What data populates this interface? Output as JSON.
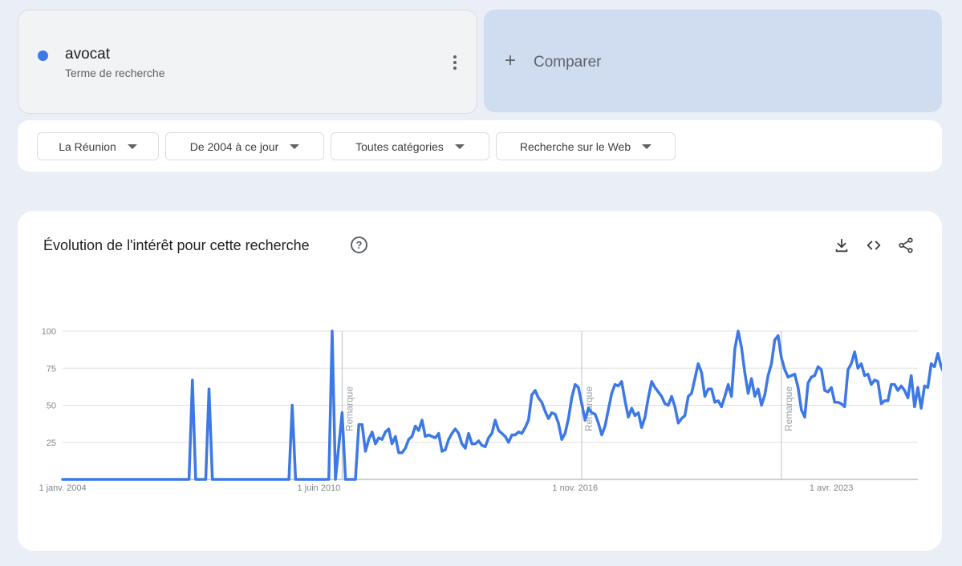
{
  "search_term": {
    "name": "avocat",
    "type_label": "Terme de recherche",
    "color": "#3c78e6"
  },
  "compare": {
    "label": "Comparer"
  },
  "filters": {
    "region": "La Réunion",
    "period": "De 2004 à ce jour",
    "category": "Toutes catégories",
    "search_type": "Recherche sur le Web"
  },
  "chart_card": {
    "title": "Évolution de l'intérêt pour cette recherche",
    "help": "?"
  },
  "chart_data": {
    "type": "line",
    "x_start": "2004-01",
    "x_end": "2025-06",
    "y_ticks": [
      "100",
      "75",
      "50",
      "25"
    ],
    "ylim": [
      0,
      100
    ],
    "x_ticks": [
      {
        "label": "1 janv. 2004",
        "date": "2004-01"
      },
      {
        "label": "1 juin 2010",
        "date": "2010-06"
      },
      {
        "label": "1 nov. 2016",
        "date": "2016-11"
      },
      {
        "label": "1 avr. 2023",
        "date": "2023-04"
      }
    ],
    "notes": [
      {
        "label": "Remarque",
        "date": "2011-01"
      },
      {
        "label": "Remarque",
        "date": "2017-01"
      },
      {
        "label": "Remarque",
        "date": "2022-01"
      }
    ],
    "series": [
      {
        "color": "#3c78e6",
        "points": [
          [
            "2004-01",
            0
          ],
          [
            "2007-03",
            0
          ],
          [
            "2007-04",
            67
          ],
          [
            "2007-05",
            0
          ],
          [
            "2007-08",
            0
          ],
          [
            "2007-09",
            61
          ],
          [
            "2007-10",
            0
          ],
          [
            "2009-09",
            0
          ],
          [
            "2009-10",
            50
          ],
          [
            "2009-11",
            0
          ],
          [
            "2010-09",
            0
          ],
          [
            "2010-10",
            100
          ],
          [
            "2010-11",
            0
          ],
          [
            "2011-01",
            45
          ],
          [
            "2011-02",
            0
          ],
          [
            "2011-05",
            0
          ],
          [
            "2011-06",
            37
          ],
          [
            "2011-07",
            37
          ],
          [
            "2011-08",
            19
          ],
          [
            "2011-09",
            27
          ],
          [
            "2011-10",
            32
          ],
          [
            "2011-11",
            24
          ],
          [
            "2011-12",
            28
          ],
          [
            "2012-01",
            27
          ],
          [
            "2012-02",
            32
          ],
          [
            "2012-03",
            34
          ],
          [
            "2012-04",
            24
          ],
          [
            "2012-05",
            29
          ],
          [
            "2012-06",
            18
          ],
          [
            "2012-07",
            18
          ],
          [
            "2012-08",
            21
          ],
          [
            "2012-09",
            27
          ],
          [
            "2012-10",
            29
          ],
          [
            "2012-11",
            36
          ],
          [
            "2012-12",
            33
          ],
          [
            "2013-01",
            40
          ],
          [
            "2013-02",
            29
          ],
          [
            "2013-03",
            30
          ],
          [
            "2013-04",
            29
          ],
          [
            "2013-05",
            28
          ],
          [
            "2013-06",
            31
          ],
          [
            "2013-07",
            19
          ],
          [
            "2013-08",
            20
          ],
          [
            "2013-09",
            27
          ],
          [
            "2013-10",
            31
          ],
          [
            "2013-11",
            34
          ],
          [
            "2013-12",
            31
          ],
          [
            "2014-01",
            24
          ],
          [
            "2014-02",
            21
          ],
          [
            "2014-03",
            31
          ],
          [
            "2014-04",
            24
          ],
          [
            "2014-05",
            24
          ],
          [
            "2014-06",
            26
          ],
          [
            "2014-07",
            23
          ],
          [
            "2014-08",
            22
          ],
          [
            "2014-09",
            28
          ],
          [
            "2014-10",
            31
          ],
          [
            "2014-11",
            40
          ],
          [
            "2014-12",
            33
          ],
          [
            "2015-01",
            31
          ],
          [
            "2015-02",
            29
          ],
          [
            "2015-03",
            25
          ],
          [
            "2015-04",
            30
          ],
          [
            "2015-05",
            30
          ],
          [
            "2015-06",
            32
          ],
          [
            "2015-07",
            31
          ],
          [
            "2015-08",
            35
          ],
          [
            "2015-09",
            40
          ],
          [
            "2015-10",
            57
          ],
          [
            "2015-11",
            60
          ],
          [
            "2015-12",
            55
          ],
          [
            "2016-01",
            52
          ],
          [
            "2016-02",
            46
          ],
          [
            "2016-03",
            41
          ],
          [
            "2016-04",
            45
          ],
          [
            "2016-05",
            44
          ],
          [
            "2016-06",
            38
          ],
          [
            "2016-07",
            27
          ],
          [
            "2016-08",
            31
          ],
          [
            "2016-09",
            41
          ],
          [
            "2016-10",
            55
          ],
          [
            "2016-11",
            64
          ],
          [
            "2016-12",
            62
          ],
          [
            "2017-01",
            51
          ],
          [
            "2017-02",
            40
          ],
          [
            "2017-03",
            48
          ],
          [
            "2017-04",
            45
          ],
          [
            "2017-05",
            44
          ],
          [
            "2017-06",
            38
          ],
          [
            "2017-07",
            30
          ],
          [
            "2017-08",
            36
          ],
          [
            "2017-09",
            47
          ],
          [
            "2017-10",
            58
          ],
          [
            "2017-11",
            64
          ],
          [
            "2017-12",
            63
          ],
          [
            "2018-01",
            66
          ],
          [
            "2018-02",
            53
          ],
          [
            "2018-03",
            42
          ],
          [
            "2018-04",
            48
          ],
          [
            "2018-05",
            43
          ],
          [
            "2018-06",
            45
          ],
          [
            "2018-07",
            35
          ],
          [
            "2018-08",
            42
          ],
          [
            "2018-09",
            55
          ],
          [
            "2018-10",
            66
          ],
          [
            "2018-11",
            62
          ],
          [
            "2018-12",
            59
          ],
          [
            "2019-01",
            56
          ],
          [
            "2019-02",
            51
          ],
          [
            "2019-03",
            50
          ],
          [
            "2019-04",
            56
          ],
          [
            "2019-05",
            49
          ],
          [
            "2019-06",
            38
          ],
          [
            "2019-07",
            41
          ],
          [
            "2019-08",
            43
          ],
          [
            "2019-09",
            56
          ],
          [
            "2019-10",
            58
          ],
          [
            "2019-11",
            68
          ],
          [
            "2019-12",
            78
          ],
          [
            "2020-01",
            72
          ],
          [
            "2020-02",
            56
          ],
          [
            "2020-03",
            61
          ],
          [
            "2020-04",
            61
          ],
          [
            "2020-05",
            52
          ],
          [
            "2020-06",
            53
          ],
          [
            "2020-07",
            49
          ],
          [
            "2020-08",
            56
          ],
          [
            "2020-09",
            64
          ],
          [
            "2020-10",
            56
          ],
          [
            "2020-11",
            88
          ],
          [
            "2020-12",
            100
          ],
          [
            "2021-01",
            89
          ],
          [
            "2021-02",
            72
          ],
          [
            "2021-03",
            58
          ],
          [
            "2021-04",
            68
          ],
          [
            "2021-05",
            56
          ],
          [
            "2021-06",
            61
          ],
          [
            "2021-07",
            50
          ],
          [
            "2021-08",
            57
          ],
          [
            "2021-09",
            70
          ],
          [
            "2021-10",
            78
          ],
          [
            "2021-11",
            94
          ],
          [
            "2021-12",
            97
          ],
          [
            "2022-01",
            82
          ],
          [
            "2022-02",
            74
          ],
          [
            "2022-03",
            69
          ],
          [
            "2022-04",
            70
          ],
          [
            "2022-05",
            71
          ],
          [
            "2022-06",
            62
          ],
          [
            "2022-07",
            47
          ],
          [
            "2022-08",
            42
          ],
          [
            "2022-09",
            65
          ],
          [
            "2022-10",
            69
          ],
          [
            "2022-11",
            70
          ],
          [
            "2022-12",
            76
          ],
          [
            "2023-01",
            74
          ],
          [
            "2023-02",
            60
          ],
          [
            "2023-03",
            59
          ],
          [
            "2023-04",
            62
          ],
          [
            "2023-05",
            52
          ],
          [
            "2023-06",
            52
          ],
          [
            "2023-07",
            51
          ],
          [
            "2023-08",
            49
          ],
          [
            "2023-09",
            74
          ],
          [
            "2023-10",
            78
          ],
          [
            "2023-11",
            86
          ],
          [
            "2023-12",
            75
          ],
          [
            "2024-01",
            78
          ],
          [
            "2024-02",
            70
          ],
          [
            "2024-03",
            71
          ],
          [
            "2024-04",
            64
          ],
          [
            "2024-05",
            67
          ],
          [
            "2024-06",
            66
          ],
          [
            "2024-07",
            51
          ],
          [
            "2024-08",
            53
          ],
          [
            "2024-09",
            53
          ],
          [
            "2024-10",
            64
          ],
          [
            "2024-11",
            64
          ],
          [
            "2024-12",
            60
          ],
          [
            "2025-01",
            63
          ],
          [
            "2025-02",
            60
          ],
          [
            "2025-03",
            55
          ],
          [
            "2025-04",
            70
          ],
          [
            "2025-05",
            49
          ],
          [
            "2025-06",
            62
          ],
          [
            "2025-07",
            48
          ],
          [
            "2025-08",
            63
          ],
          [
            "2025-09",
            62
          ],
          [
            "2025-10",
            78
          ],
          [
            "2025-11",
            76
          ],
          [
            "2025-12",
            85
          ],
          [
            "2026-01",
            76
          ],
          [
            "2026-02",
            71
          ]
        ]
      }
    ]
  }
}
